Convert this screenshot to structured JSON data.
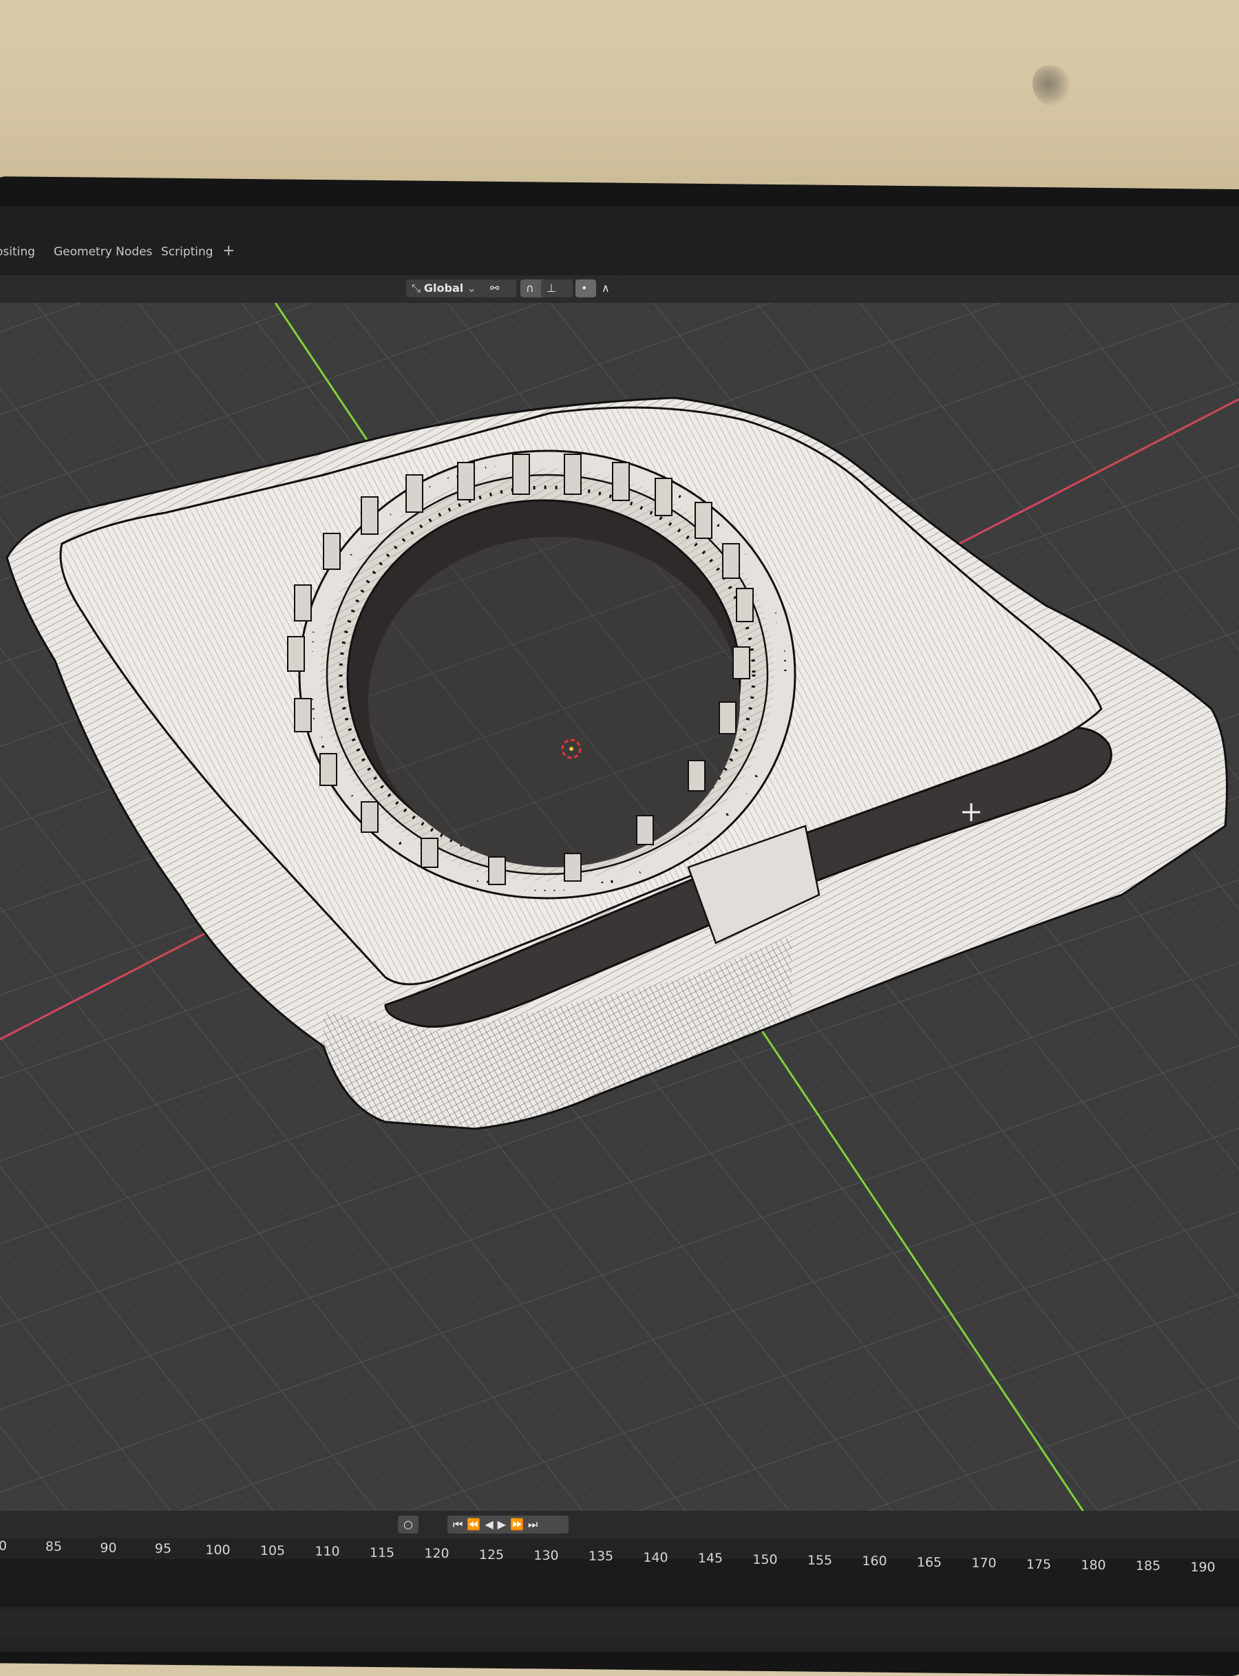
{
  "workspace_tabs": {
    "compositing": "ositing",
    "geometry_nodes": "Geometry Nodes",
    "scripting": "Scripting",
    "add": "+"
  },
  "header": {
    "orientation": "Global",
    "orientation_icon": "transform-orientation-icon",
    "pivot_icon": "link-icon",
    "snap_icon": "magnet-icon",
    "snap_mode_icon": "snap-increment-icon",
    "proportional_icon": "proportional-edit-icon",
    "falloff_icon": "falloff-curve-icon"
  },
  "timeline": {
    "frame_numbers": [
      "0",
      "85",
      "90",
      "95",
      "100",
      "105",
      "110",
      "115",
      "120",
      "125",
      "130",
      "135",
      "140",
      "145",
      "150",
      "155",
      "160",
      "165",
      "170",
      "175",
      "180",
      "185",
      "190"
    ],
    "record_icon": "record-icon",
    "jump_start_icon": "jump-to-start-icon",
    "prev_key_icon": "previous-keyframe-icon",
    "play_reverse_icon": "play-reverse-icon",
    "play_icon": "play-icon",
    "next_key_icon": "next-keyframe-icon",
    "jump_end_icon": "jump-to-end-icon"
  },
  "colors": {
    "viewport_bg": "#3c3c3c",
    "grid_line": "#4b4b4b",
    "x_axis": "#d2465a",
    "y_axis": "#7fd13b",
    "mesh_face": "#ece8e4",
    "mesh_wire": "#111111"
  }
}
